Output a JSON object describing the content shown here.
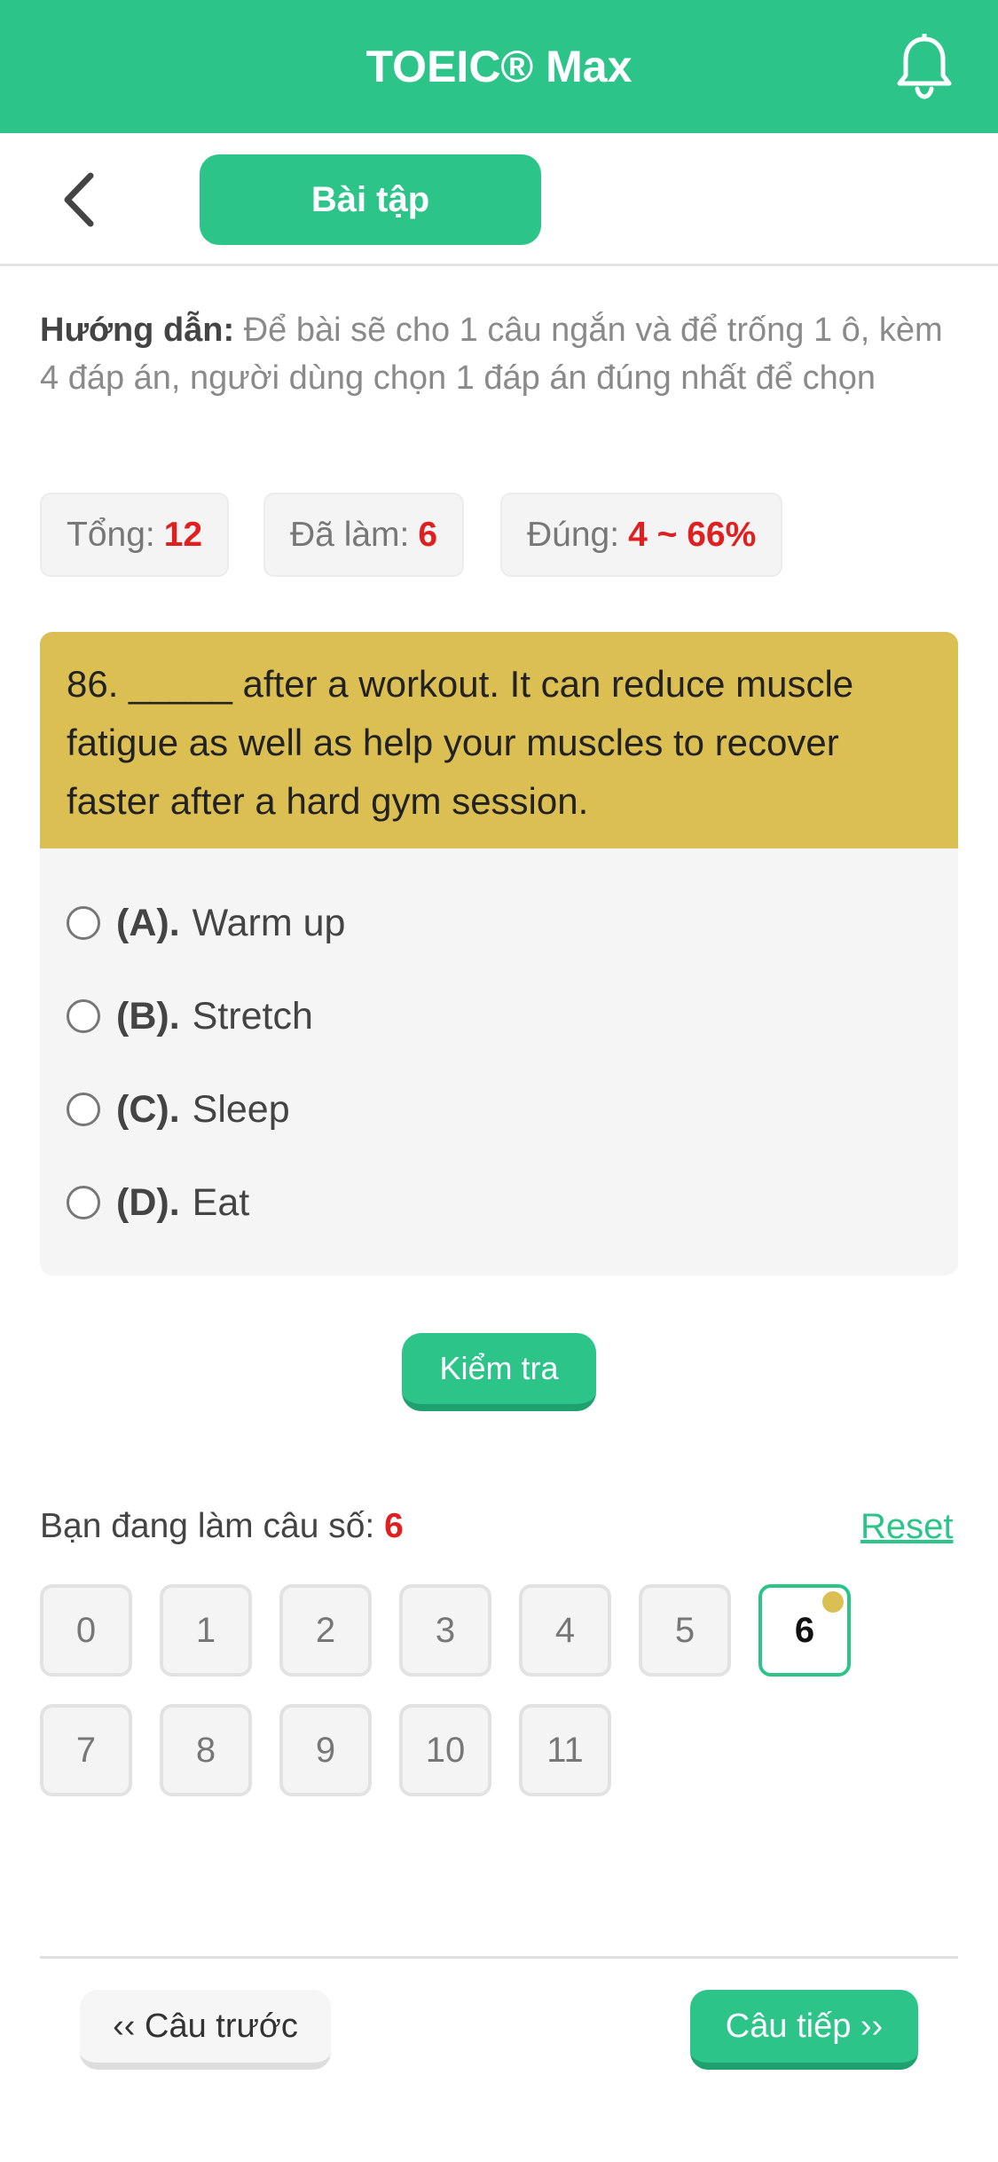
{
  "header": {
    "title": "TOEIC® Max"
  },
  "subbar": {
    "tab_label": "Bài tập"
  },
  "guide": {
    "label": "Hướng dẫn:",
    "text": " Để bài sẽ cho 1 câu ngắn và để trống 1 ô, kèm 4 đáp án, người dùng chọn 1 đáp án đúng nhất để chọn"
  },
  "stats": {
    "total_label": "Tổng:",
    "total_value": "12",
    "done_label": "Đã làm:",
    "done_value": "6",
    "correct_label": "Đúng:",
    "correct_value": "4 ~ 66%"
  },
  "question": {
    "text": "86. _____ after a workout. It can reduce muscle fatigue as well as help your muscles to recover faster after a hard gym session.",
    "options": [
      {
        "key": "(A).",
        "text": "Warm up"
      },
      {
        "key": "(B).",
        "text": "Stretch"
      },
      {
        "key": "(C).",
        "text": "Sleep"
      },
      {
        "key": "(D).",
        "text": "Eat"
      }
    ]
  },
  "check_label": "Kiểm tra",
  "progress": {
    "label": "Bạn đang làm câu số: ",
    "current": "6",
    "reset_label": "Reset"
  },
  "numbers": [
    "0",
    "1",
    "2",
    "3",
    "4",
    "5",
    "6",
    "7",
    "8",
    "9",
    "10",
    "11"
  ],
  "nav": {
    "prev_label": "‹‹ Câu trước",
    "next_label": "Câu tiếp ››"
  },
  "colors": {
    "accent": "#2dc48a",
    "question_bg": "#dcbf52",
    "highlight": "#e02020"
  }
}
